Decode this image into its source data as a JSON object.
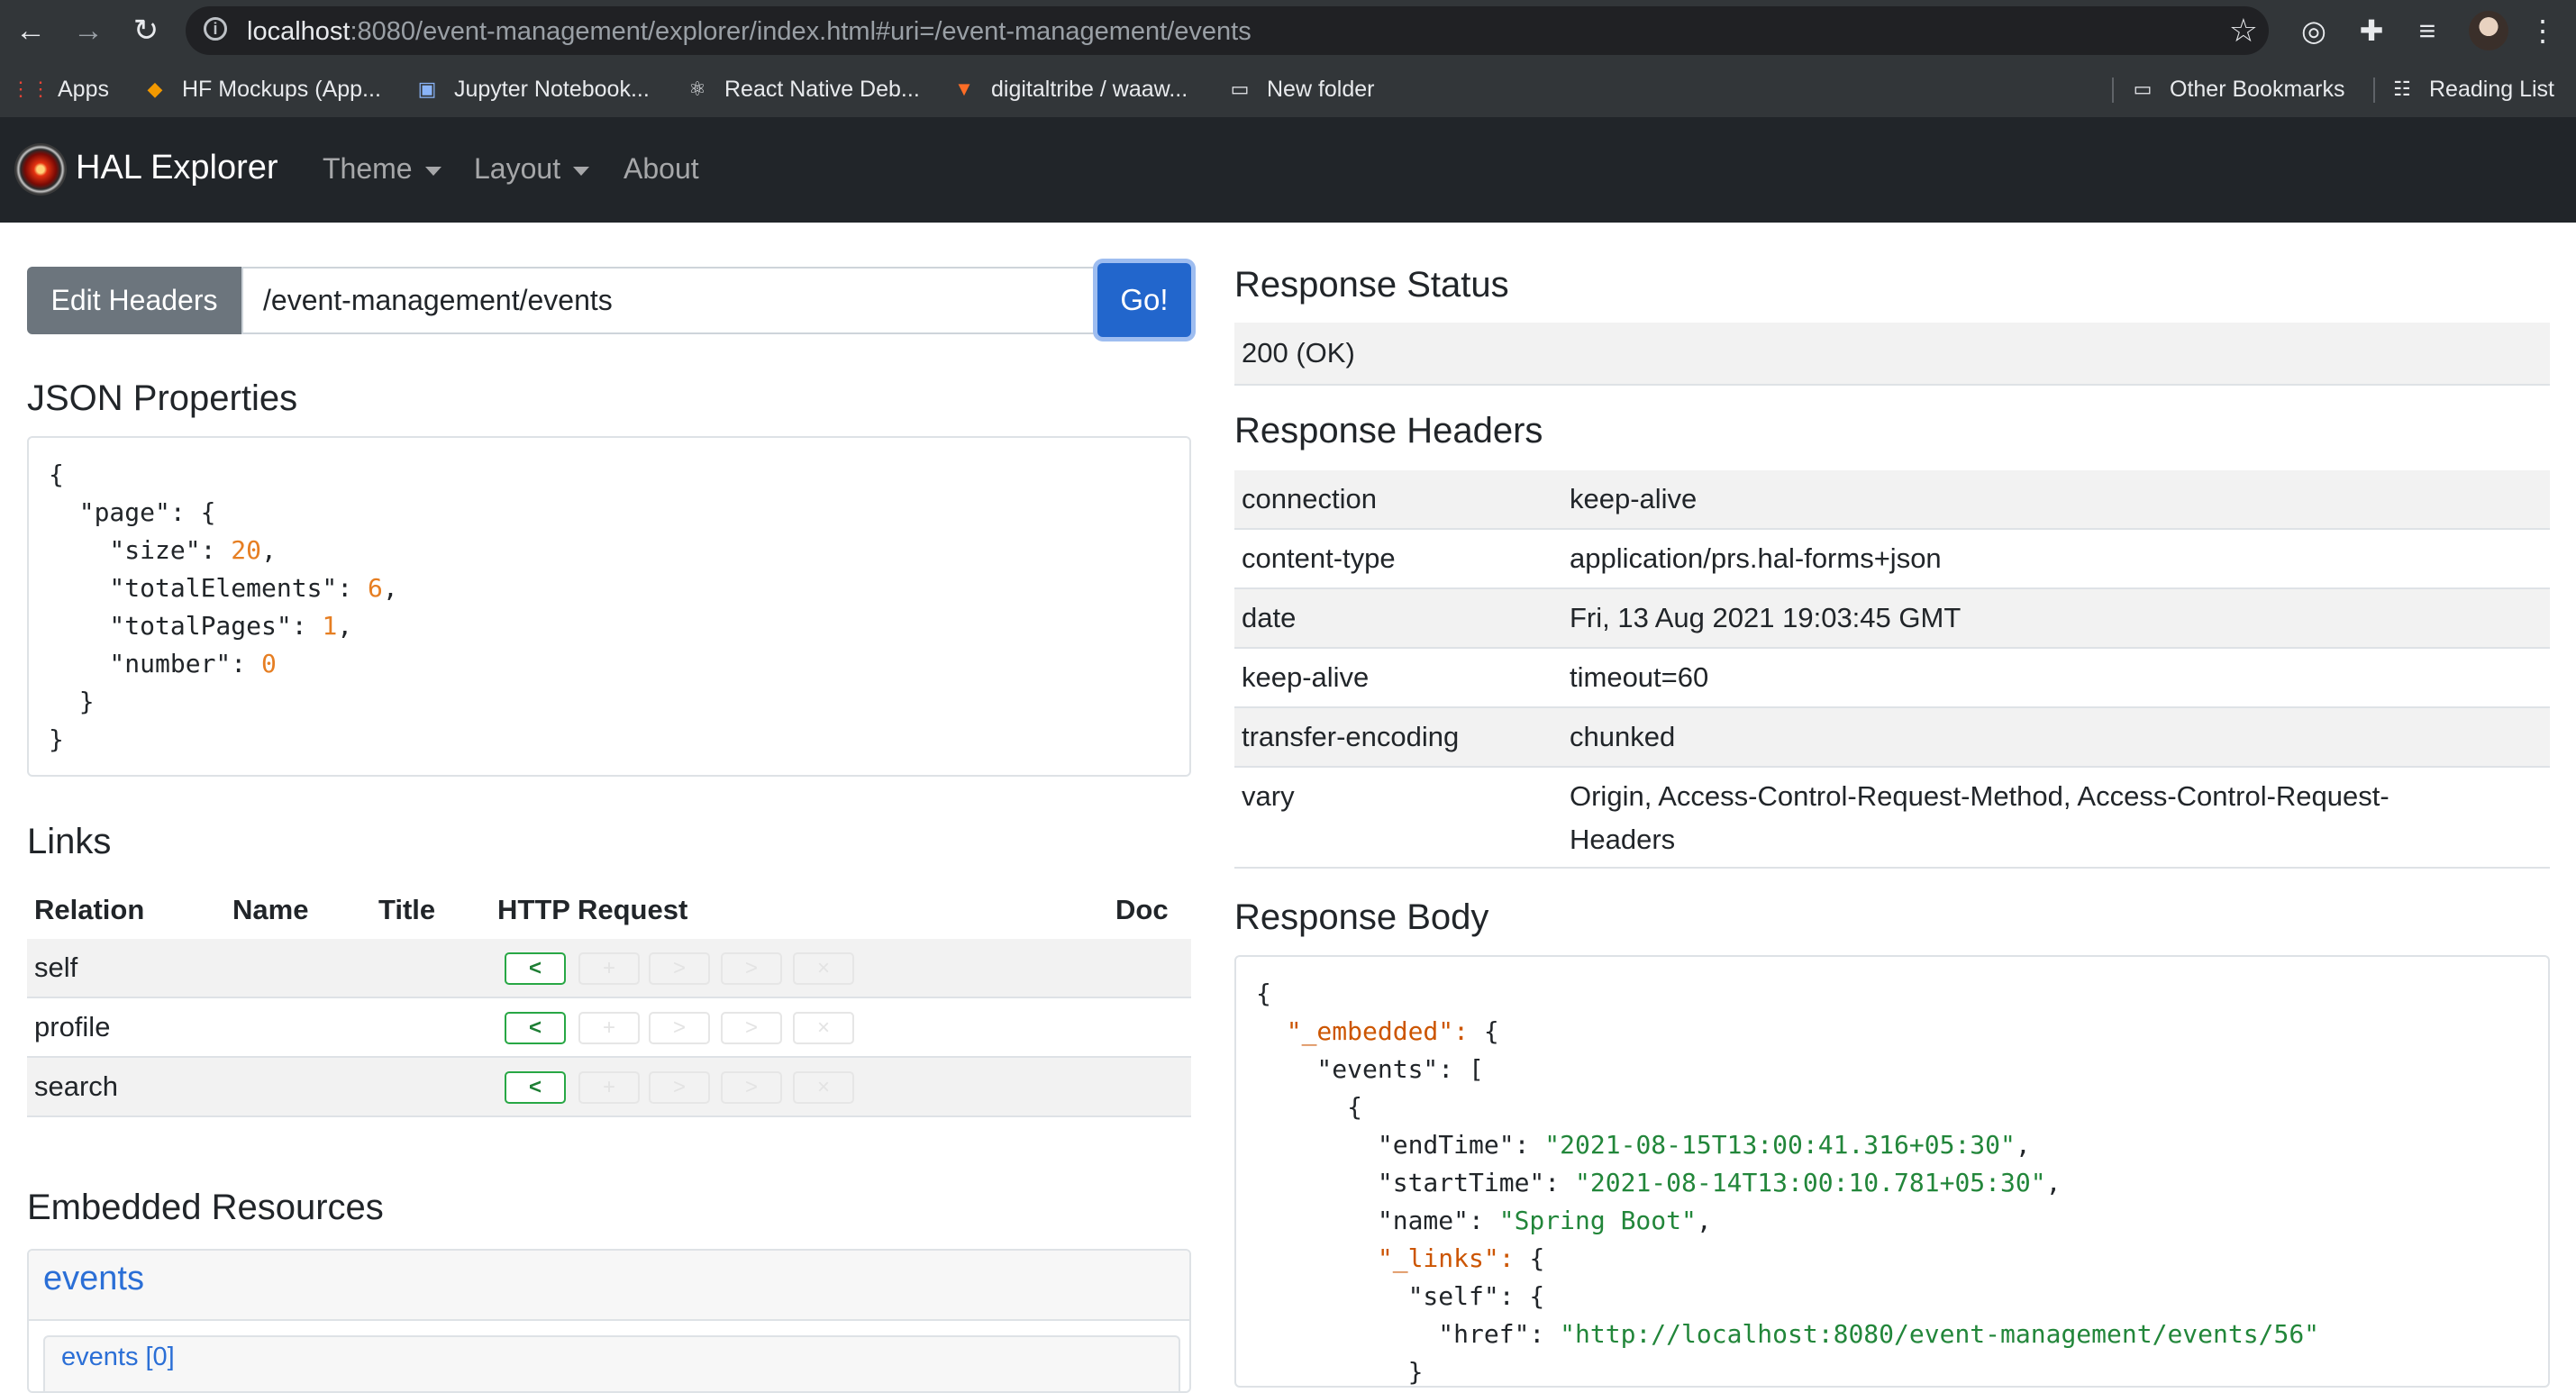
{
  "browser": {
    "url_host": "localhost",
    "url_rest": ":8080/event-management/explorer/index.html#uri=/event-management/events",
    "bookmarks": [
      "Apps",
      "HF Mockups (App...",
      "Jupyter Notebook...",
      "React Native Deb...",
      "digitaltribe / waaw...",
      "New folder"
    ],
    "other_bookmarks": "Other Bookmarks",
    "reading_list": "Reading List"
  },
  "navbar": {
    "brand": "HAL Explorer",
    "theme": "Theme",
    "layout": "Layout",
    "about": "About"
  },
  "request": {
    "edit_headers": "Edit Headers",
    "uri_value": "/event-management/events",
    "go": "Go!"
  },
  "json_properties": {
    "title": "JSON Properties",
    "lines": [
      {
        "text": "{",
        "num": ""
      },
      {
        "text": "  \"page\": {",
        "num": ""
      },
      {
        "text": "    \"size\": ",
        "num": "20",
        "tail": ","
      },
      {
        "text": "    \"totalElements\": ",
        "num": "6",
        "tail": ","
      },
      {
        "text": "    \"totalPages\": ",
        "num": "1",
        "tail": ","
      },
      {
        "text": "    \"number\": ",
        "num": "0",
        "tail": ""
      },
      {
        "text": "  }",
        "num": ""
      },
      {
        "text": "}",
        "num": ""
      }
    ]
  },
  "links": {
    "title": "Links",
    "headers": [
      "Relation",
      "Name",
      "Title",
      "HTTP Request",
      "Doc"
    ],
    "rows": [
      {
        "relation": "self"
      },
      {
        "relation": "profile"
      },
      {
        "relation": "search"
      }
    ],
    "get_glyph": "<",
    "disabled_glyphs": [
      "+",
      ">",
      ">",
      "×"
    ]
  },
  "embedded": {
    "title": "Embedded Resources",
    "resource": "events",
    "item": "events [0]"
  },
  "response": {
    "status_title": "Response Status",
    "status": "200 (OK)",
    "headers_title": "Response Headers",
    "headers": [
      {
        "name": "connection",
        "value": "keep-alive"
      },
      {
        "name": "content-type",
        "value": "application/prs.hal-forms+json"
      },
      {
        "name": "date",
        "value": "Fri, 13 Aug 2021 19:03:45 GMT"
      },
      {
        "name": "keep-alive",
        "value": "timeout=60"
      },
      {
        "name": "transfer-encoding",
        "value": "chunked"
      },
      {
        "name": "vary",
        "value": "Origin, Access-Control-Request-Method, Access-Control-Request-",
        "value2": "Headers"
      }
    ],
    "body_title": "Response Body",
    "body_lines": [
      {
        "pre": "{",
        "key": "",
        "mid": "",
        "str": "",
        "post": ""
      },
      {
        "pre": "  ",
        "key": "\"_embedded\": ",
        "mid": "{",
        "str": "",
        "post": ""
      },
      {
        "pre": "    \"events\": [",
        "key": "",
        "mid": "",
        "str": "",
        "post": ""
      },
      {
        "pre": "      {",
        "key": "",
        "mid": "",
        "str": "",
        "post": ""
      },
      {
        "pre": "        \"endTime\": ",
        "key": "",
        "mid": "",
        "str": "\"2021-08-15T13:00:41.316+05:30\"",
        "post": ","
      },
      {
        "pre": "        \"startTime\": ",
        "key": "",
        "mid": "",
        "str": "\"2021-08-14T13:00:10.781+05:30\"",
        "post": ","
      },
      {
        "pre": "        \"name\": ",
        "key": "",
        "mid": "",
        "str": "\"Spring Boot\"",
        "post": ","
      },
      {
        "pre": "        ",
        "key": "\"_links\": ",
        "mid": "{",
        "str": "",
        "post": ""
      },
      {
        "pre": "          \"self\": {",
        "key": "",
        "mid": "",
        "str": "",
        "post": ""
      },
      {
        "pre": "            \"href\": ",
        "key": "",
        "mid": "",
        "str": "\"http://localhost:8080/event-management/events/56\"",
        "post": ""
      },
      {
        "pre": "          }",
        "key": "",
        "mid": "",
        "str": "",
        "post": ""
      }
    ]
  }
}
